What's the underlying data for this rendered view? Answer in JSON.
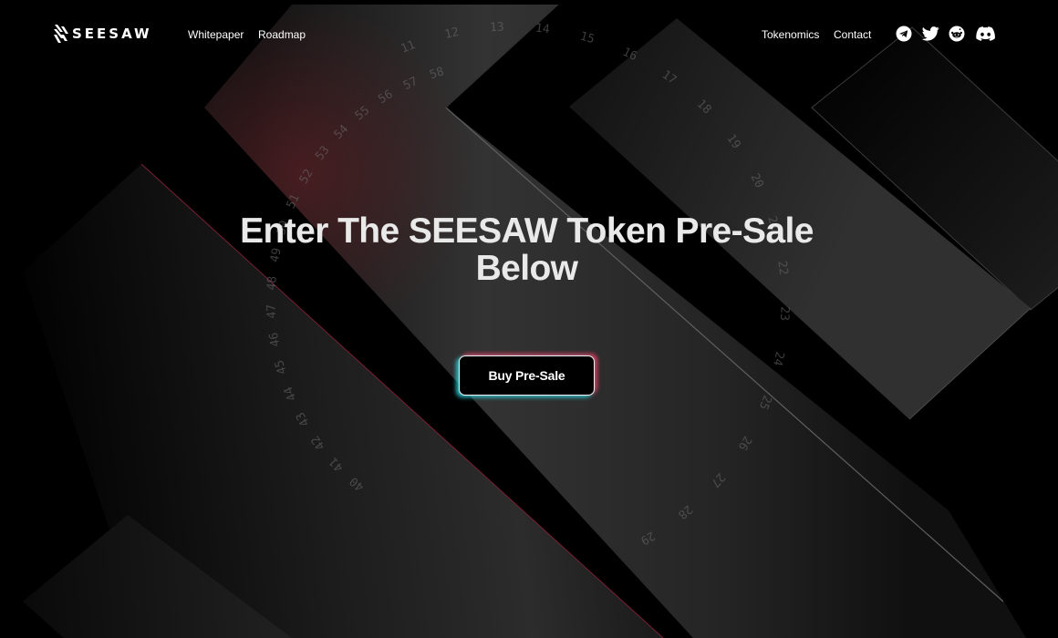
{
  "brand": {
    "name": "SEESAW"
  },
  "nav": {
    "left_links": [
      "Whitepaper",
      "Roadmap"
    ],
    "right_links": [
      "Tokenomics",
      "Contact"
    ],
    "social_icons": [
      "telegram-icon",
      "twitter-icon",
      "reddit-icon",
      "discord-icon"
    ]
  },
  "hero": {
    "title_line1": "Enter The SEESAW Token Pre-Sale",
    "title_line2": "Below",
    "cta_label": "Buy Pre-Sale"
  },
  "background": {
    "dial_numbers_left": [
      "40",
      "41",
      "42",
      "43",
      "44",
      "45",
      "46",
      "47",
      "48",
      "49",
      "50",
      "51",
      "52",
      "53",
      "54",
      "55",
      "56",
      "57",
      "58"
    ],
    "dial_numbers_right": [
      "11",
      "12",
      "13",
      "14",
      "15",
      "16",
      "17",
      "18",
      "19",
      "20",
      "21",
      "22",
      "23",
      "24",
      "25",
      "26",
      "27",
      "28",
      "29"
    ]
  },
  "colors": {
    "background": "#000000",
    "text": "#ffffff",
    "title": "#e9e9e9",
    "glow_cyan": "#28d7e1",
    "glow_pink": "#eb4169",
    "accent_line": "#7a2036"
  }
}
